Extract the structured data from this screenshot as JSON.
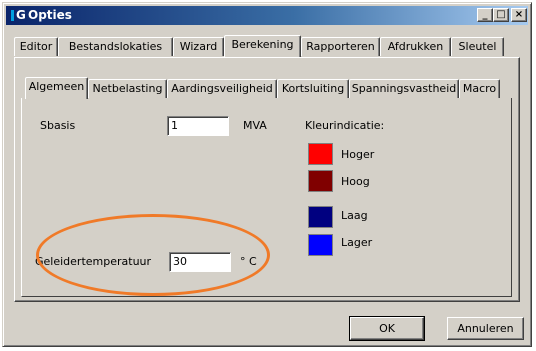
{
  "window": {
    "app_icon_letter": "G",
    "title": "Opties",
    "controls": {
      "minimize": "_",
      "maximize": "□",
      "close": "×"
    }
  },
  "main_tabs": [
    "Editor",
    "Bestandslokaties",
    "Wizard",
    "Berekening",
    "Rapporteren",
    "Afdrukken",
    "Sleutel"
  ],
  "main_tabs_active": "Berekening",
  "sub_tabs": [
    "Algemeen",
    "Netbelasting",
    "Aardingsveiligheid",
    "Kortsluiting",
    "Spanningsvastheid",
    "Macro"
  ],
  "sub_tabs_active": "Algemeen",
  "form": {
    "sbasis_label": "Sbasis",
    "sbasis_value": "1",
    "sbasis_unit": "MVA",
    "temp_label": "Geleidertemperatuur",
    "temp_value": "30",
    "temp_unit": "° C"
  },
  "color_indication": {
    "title": "Kleurindicatie:",
    "items": [
      {
        "label": "Hoger",
        "color": "#ff0000"
      },
      {
        "label": "Hoog",
        "color": "#800000"
      },
      {
        "label": "Laag",
        "color": "#000080"
      },
      {
        "label": "Lager",
        "color": "#0000ff"
      }
    ]
  },
  "buttons": {
    "ok": "OK",
    "cancel": "Annuleren"
  },
  "annotation_color": "#f07a28"
}
